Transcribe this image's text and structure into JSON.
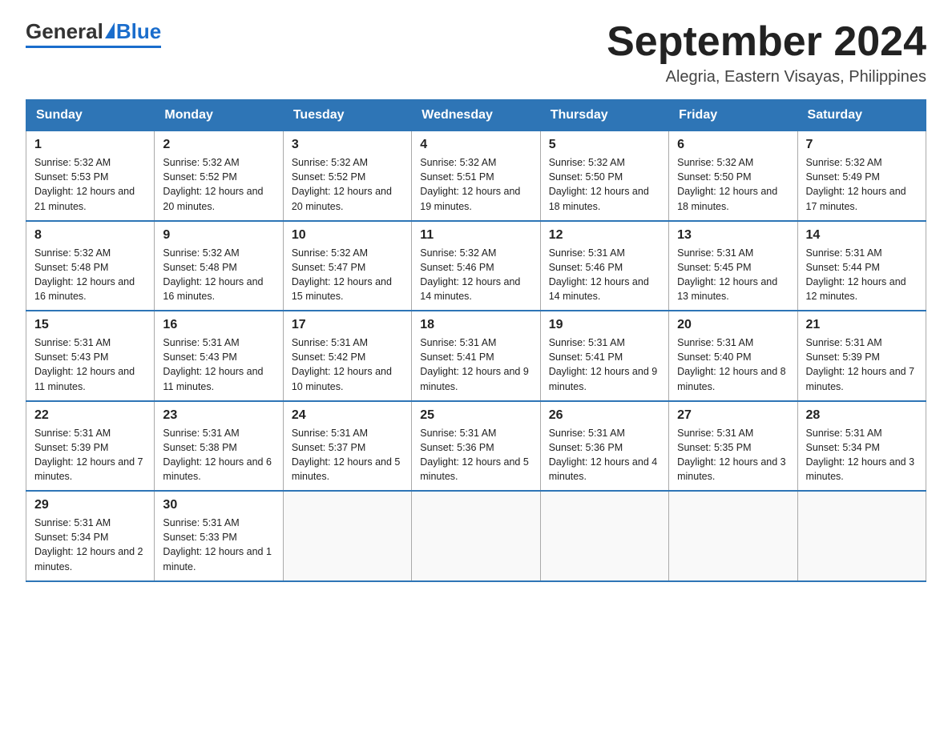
{
  "header": {
    "logo_general": "General",
    "logo_blue": "Blue",
    "month_title": "September 2024",
    "subtitle": "Alegria, Eastern Visayas, Philippines"
  },
  "calendar": {
    "days_of_week": [
      "Sunday",
      "Monday",
      "Tuesday",
      "Wednesday",
      "Thursday",
      "Friday",
      "Saturday"
    ],
    "weeks": [
      [
        {
          "day": "1",
          "sunrise": "Sunrise: 5:32 AM",
          "sunset": "Sunset: 5:53 PM",
          "daylight": "Daylight: 12 hours and 21 minutes."
        },
        {
          "day": "2",
          "sunrise": "Sunrise: 5:32 AM",
          "sunset": "Sunset: 5:52 PM",
          "daylight": "Daylight: 12 hours and 20 minutes."
        },
        {
          "day": "3",
          "sunrise": "Sunrise: 5:32 AM",
          "sunset": "Sunset: 5:52 PM",
          "daylight": "Daylight: 12 hours and 20 minutes."
        },
        {
          "day": "4",
          "sunrise": "Sunrise: 5:32 AM",
          "sunset": "Sunset: 5:51 PM",
          "daylight": "Daylight: 12 hours and 19 minutes."
        },
        {
          "day": "5",
          "sunrise": "Sunrise: 5:32 AM",
          "sunset": "Sunset: 5:50 PM",
          "daylight": "Daylight: 12 hours and 18 minutes."
        },
        {
          "day": "6",
          "sunrise": "Sunrise: 5:32 AM",
          "sunset": "Sunset: 5:50 PM",
          "daylight": "Daylight: 12 hours and 18 minutes."
        },
        {
          "day": "7",
          "sunrise": "Sunrise: 5:32 AM",
          "sunset": "Sunset: 5:49 PM",
          "daylight": "Daylight: 12 hours and 17 minutes."
        }
      ],
      [
        {
          "day": "8",
          "sunrise": "Sunrise: 5:32 AM",
          "sunset": "Sunset: 5:48 PM",
          "daylight": "Daylight: 12 hours and 16 minutes."
        },
        {
          "day": "9",
          "sunrise": "Sunrise: 5:32 AM",
          "sunset": "Sunset: 5:48 PM",
          "daylight": "Daylight: 12 hours and 16 minutes."
        },
        {
          "day": "10",
          "sunrise": "Sunrise: 5:32 AM",
          "sunset": "Sunset: 5:47 PM",
          "daylight": "Daylight: 12 hours and 15 minutes."
        },
        {
          "day": "11",
          "sunrise": "Sunrise: 5:32 AM",
          "sunset": "Sunset: 5:46 PM",
          "daylight": "Daylight: 12 hours and 14 minutes."
        },
        {
          "day": "12",
          "sunrise": "Sunrise: 5:31 AM",
          "sunset": "Sunset: 5:46 PM",
          "daylight": "Daylight: 12 hours and 14 minutes."
        },
        {
          "day": "13",
          "sunrise": "Sunrise: 5:31 AM",
          "sunset": "Sunset: 5:45 PM",
          "daylight": "Daylight: 12 hours and 13 minutes."
        },
        {
          "day": "14",
          "sunrise": "Sunrise: 5:31 AM",
          "sunset": "Sunset: 5:44 PM",
          "daylight": "Daylight: 12 hours and 12 minutes."
        }
      ],
      [
        {
          "day": "15",
          "sunrise": "Sunrise: 5:31 AM",
          "sunset": "Sunset: 5:43 PM",
          "daylight": "Daylight: 12 hours and 11 minutes."
        },
        {
          "day": "16",
          "sunrise": "Sunrise: 5:31 AM",
          "sunset": "Sunset: 5:43 PM",
          "daylight": "Daylight: 12 hours and 11 minutes."
        },
        {
          "day": "17",
          "sunrise": "Sunrise: 5:31 AM",
          "sunset": "Sunset: 5:42 PM",
          "daylight": "Daylight: 12 hours and 10 minutes."
        },
        {
          "day": "18",
          "sunrise": "Sunrise: 5:31 AM",
          "sunset": "Sunset: 5:41 PM",
          "daylight": "Daylight: 12 hours and 9 minutes."
        },
        {
          "day": "19",
          "sunrise": "Sunrise: 5:31 AM",
          "sunset": "Sunset: 5:41 PM",
          "daylight": "Daylight: 12 hours and 9 minutes."
        },
        {
          "day": "20",
          "sunrise": "Sunrise: 5:31 AM",
          "sunset": "Sunset: 5:40 PM",
          "daylight": "Daylight: 12 hours and 8 minutes."
        },
        {
          "day": "21",
          "sunrise": "Sunrise: 5:31 AM",
          "sunset": "Sunset: 5:39 PM",
          "daylight": "Daylight: 12 hours and 7 minutes."
        }
      ],
      [
        {
          "day": "22",
          "sunrise": "Sunrise: 5:31 AM",
          "sunset": "Sunset: 5:39 PM",
          "daylight": "Daylight: 12 hours and 7 minutes."
        },
        {
          "day": "23",
          "sunrise": "Sunrise: 5:31 AM",
          "sunset": "Sunset: 5:38 PM",
          "daylight": "Daylight: 12 hours and 6 minutes."
        },
        {
          "day": "24",
          "sunrise": "Sunrise: 5:31 AM",
          "sunset": "Sunset: 5:37 PM",
          "daylight": "Daylight: 12 hours and 5 minutes."
        },
        {
          "day": "25",
          "sunrise": "Sunrise: 5:31 AM",
          "sunset": "Sunset: 5:36 PM",
          "daylight": "Daylight: 12 hours and 5 minutes."
        },
        {
          "day": "26",
          "sunrise": "Sunrise: 5:31 AM",
          "sunset": "Sunset: 5:36 PM",
          "daylight": "Daylight: 12 hours and 4 minutes."
        },
        {
          "day": "27",
          "sunrise": "Sunrise: 5:31 AM",
          "sunset": "Sunset: 5:35 PM",
          "daylight": "Daylight: 12 hours and 3 minutes."
        },
        {
          "day": "28",
          "sunrise": "Sunrise: 5:31 AM",
          "sunset": "Sunset: 5:34 PM",
          "daylight": "Daylight: 12 hours and 3 minutes."
        }
      ],
      [
        {
          "day": "29",
          "sunrise": "Sunrise: 5:31 AM",
          "sunset": "Sunset: 5:34 PM",
          "daylight": "Daylight: 12 hours and 2 minutes."
        },
        {
          "day": "30",
          "sunrise": "Sunrise: 5:31 AM",
          "sunset": "Sunset: 5:33 PM",
          "daylight": "Daylight: 12 hours and 1 minute."
        },
        null,
        null,
        null,
        null,
        null
      ]
    ]
  }
}
